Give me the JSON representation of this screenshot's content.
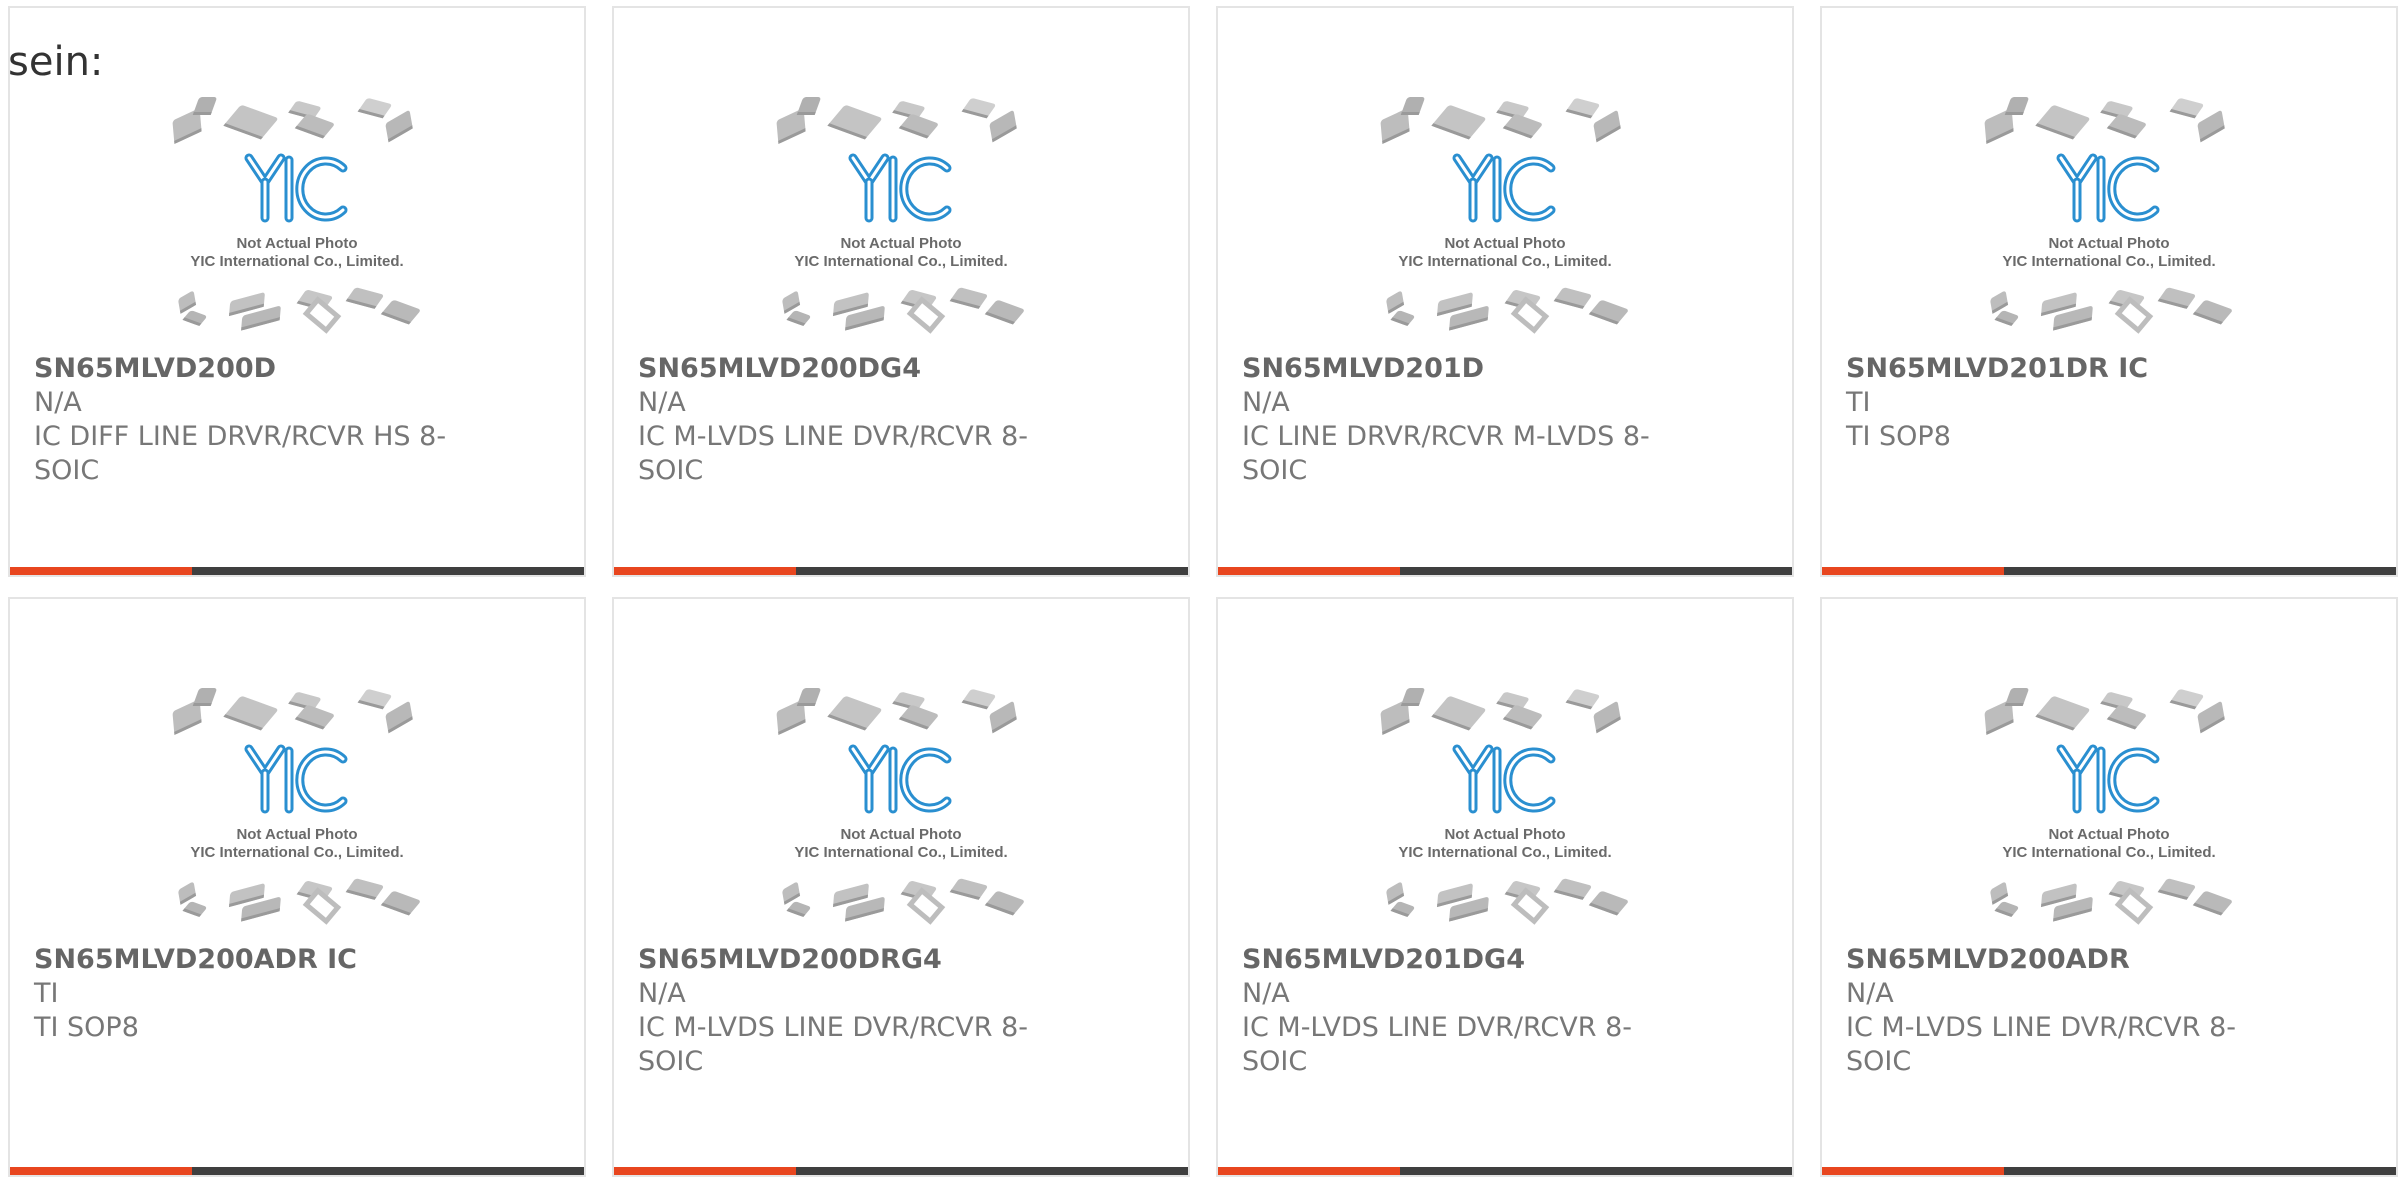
{
  "heading": "sein:",
  "image_caption": {
    "line1": "Not Actual Photo",
    "line2": "YIC International Co., Limited."
  },
  "logo_text": "YIC",
  "colors": {
    "accent": "#e8461f",
    "bar": "#3f3f3f",
    "logo_blue": "#2a8fd0"
  },
  "products": [
    {
      "part": "SN65MLVD200D",
      "line2": "N/A",
      "desc1": "IC DIFF LINE DRVR/RCVR HS 8-",
      "desc2": "SOIC"
    },
    {
      "part": "SN65MLVD200DG4",
      "line2": "N/A",
      "desc1": "IC M-LVDS LINE DVR/RCVR 8-",
      "desc2": "SOIC"
    },
    {
      "part": "SN65MLVD201D",
      "line2": "N/A",
      "desc1": "IC LINE DRVR/RCVR M-LVDS 8-",
      "desc2": "SOIC"
    },
    {
      "part": "SN65MLVD201DR IC",
      "line2": "TI",
      "desc1": "TI SOP8",
      "desc2": ""
    },
    {
      "part": "SN65MLVD200ADR IC",
      "line2": "TI",
      "desc1": "TI SOP8",
      "desc2": ""
    },
    {
      "part": "SN65MLVD200DRG4",
      "line2": "N/A",
      "desc1": "IC M-LVDS LINE DVR/RCVR 8-",
      "desc2": "SOIC"
    },
    {
      "part": "SN65MLVD201DG4",
      "line2": "N/A",
      "desc1": "IC M-LVDS LINE DVR/RCVR 8-",
      "desc2": "SOIC"
    },
    {
      "part": "SN65MLVD200ADR",
      "line2": "N/A",
      "desc1": "IC M-LVDS LINE DVR/RCVR 8-",
      "desc2": "SOIC"
    }
  ]
}
